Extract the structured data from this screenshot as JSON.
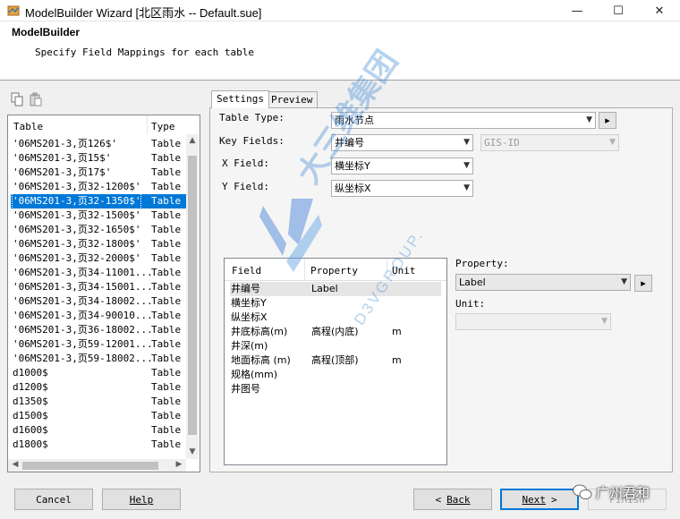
{
  "window": {
    "title": "ModelBuilder Wizard [北区雨水 -- Default.sue]",
    "controls": [
      "minimize-icon",
      "maximize-icon",
      "close-icon"
    ]
  },
  "header": {
    "title": "ModelBuilder",
    "subtitle": "Specify Field Mappings for each table"
  },
  "toolbar": {
    "icons": [
      "copy-icon",
      "paste-icon"
    ]
  },
  "table_list": {
    "columns": [
      "Table",
      "Type"
    ],
    "selected_index": 5,
    "rows": [
      {
        "name": "'06MS201-3,页126$'",
        "type": "Table"
      },
      {
        "name": "'06MS201-3,页15$'",
        "type": "Table"
      },
      {
        "name": "'06MS201-3,页17$'",
        "type": "Table"
      },
      {
        "name": "'06MS201-3,页32-1200$'",
        "type": "Table"
      },
      {
        "name": "'06MS201-3,页32-1350$'",
        "type": "Table"
      },
      {
        "name": "'06MS201-3,页32-1500$'",
        "type": "Table"
      },
      {
        "name": "'06MS201-3,页32-1650$'",
        "type": "Table"
      },
      {
        "name": "'06MS201-3,页32-1800$'",
        "type": "Table"
      },
      {
        "name": "'06MS201-3,页32-2000$'",
        "type": "Table"
      },
      {
        "name": "'06MS201-3,页34-11001...",
        "type": "Table"
      },
      {
        "name": "'06MS201-3,页34-15001...",
        "type": "Table"
      },
      {
        "name": "'06MS201-3,页34-18002...",
        "type": "Table"
      },
      {
        "name": "'06MS201-3,页34-90010...",
        "type": "Table"
      },
      {
        "name": "'06MS201-3,页36-18002...",
        "type": "Table"
      },
      {
        "name": "'06MS201-3,页59-12001...",
        "type": "Table"
      },
      {
        "name": "'06MS201-3,页59-18002...",
        "type": "Table"
      },
      {
        "name": "d1000$",
        "type": "Table"
      },
      {
        "name": "d1200$",
        "type": "Table"
      },
      {
        "name": "d1350$",
        "type": "Table"
      },
      {
        "name": "d1500$",
        "type": "Table"
      },
      {
        "name": "d1600$",
        "type": "Table"
      },
      {
        "name": "d1800$",
        "type": "Table"
      }
    ]
  },
  "tabs": [
    {
      "label": "Settings",
      "active": true
    },
    {
      "label": "Preview",
      "active": false
    }
  ],
  "settings": {
    "table_type_label": "Table Type:",
    "table_type_value": "雨水节点",
    "key_fields_label": "Key Fields:",
    "key_field_1": "井编号",
    "key_field_2": "GIS-ID",
    "x_field_label": "X Field:",
    "x_field_value": "横坐标Y",
    "y_field_label": "Y Field:",
    "y_field_value": "纵坐标X",
    "expand_button": "▸",
    "property_label": "Property:",
    "property_value": "Label",
    "unit_label": "Unit:",
    "unit_value": ""
  },
  "field_grid": {
    "columns": [
      "Field",
      "Property",
      "Unit"
    ],
    "rows": [
      {
        "field": "井编号",
        "property": "Label",
        "unit": ""
      },
      {
        "field": "横坐标Y",
        "property": "",
        "unit": ""
      },
      {
        "field": "纵坐标X",
        "property": "",
        "unit": ""
      },
      {
        "field": "井底标高(m)",
        "property": "高程(内底)",
        "unit": "m"
      },
      {
        "field": "井深(m)",
        "property": "",
        "unit": ""
      },
      {
        "field": "地面标高 (m)",
        "property": "高程(顶部)",
        "unit": "m"
      },
      {
        "field": "规格(mm)",
        "property": "",
        "unit": ""
      },
      {
        "field": "井图号",
        "property": "",
        "unit": ""
      }
    ]
  },
  "buttons": {
    "cancel": "Cancel",
    "help": "Help",
    "back": "Back",
    "next": "Next",
    "finish": "Finish"
  },
  "watermark": {
    "cn": "大三维集团",
    "en": "D3VGROUP.",
    "wechat": "广州君和"
  },
  "colors": {
    "selection": "#0078d7",
    "default_button_border": "#0078d7",
    "watermark": "#4a90d9"
  }
}
